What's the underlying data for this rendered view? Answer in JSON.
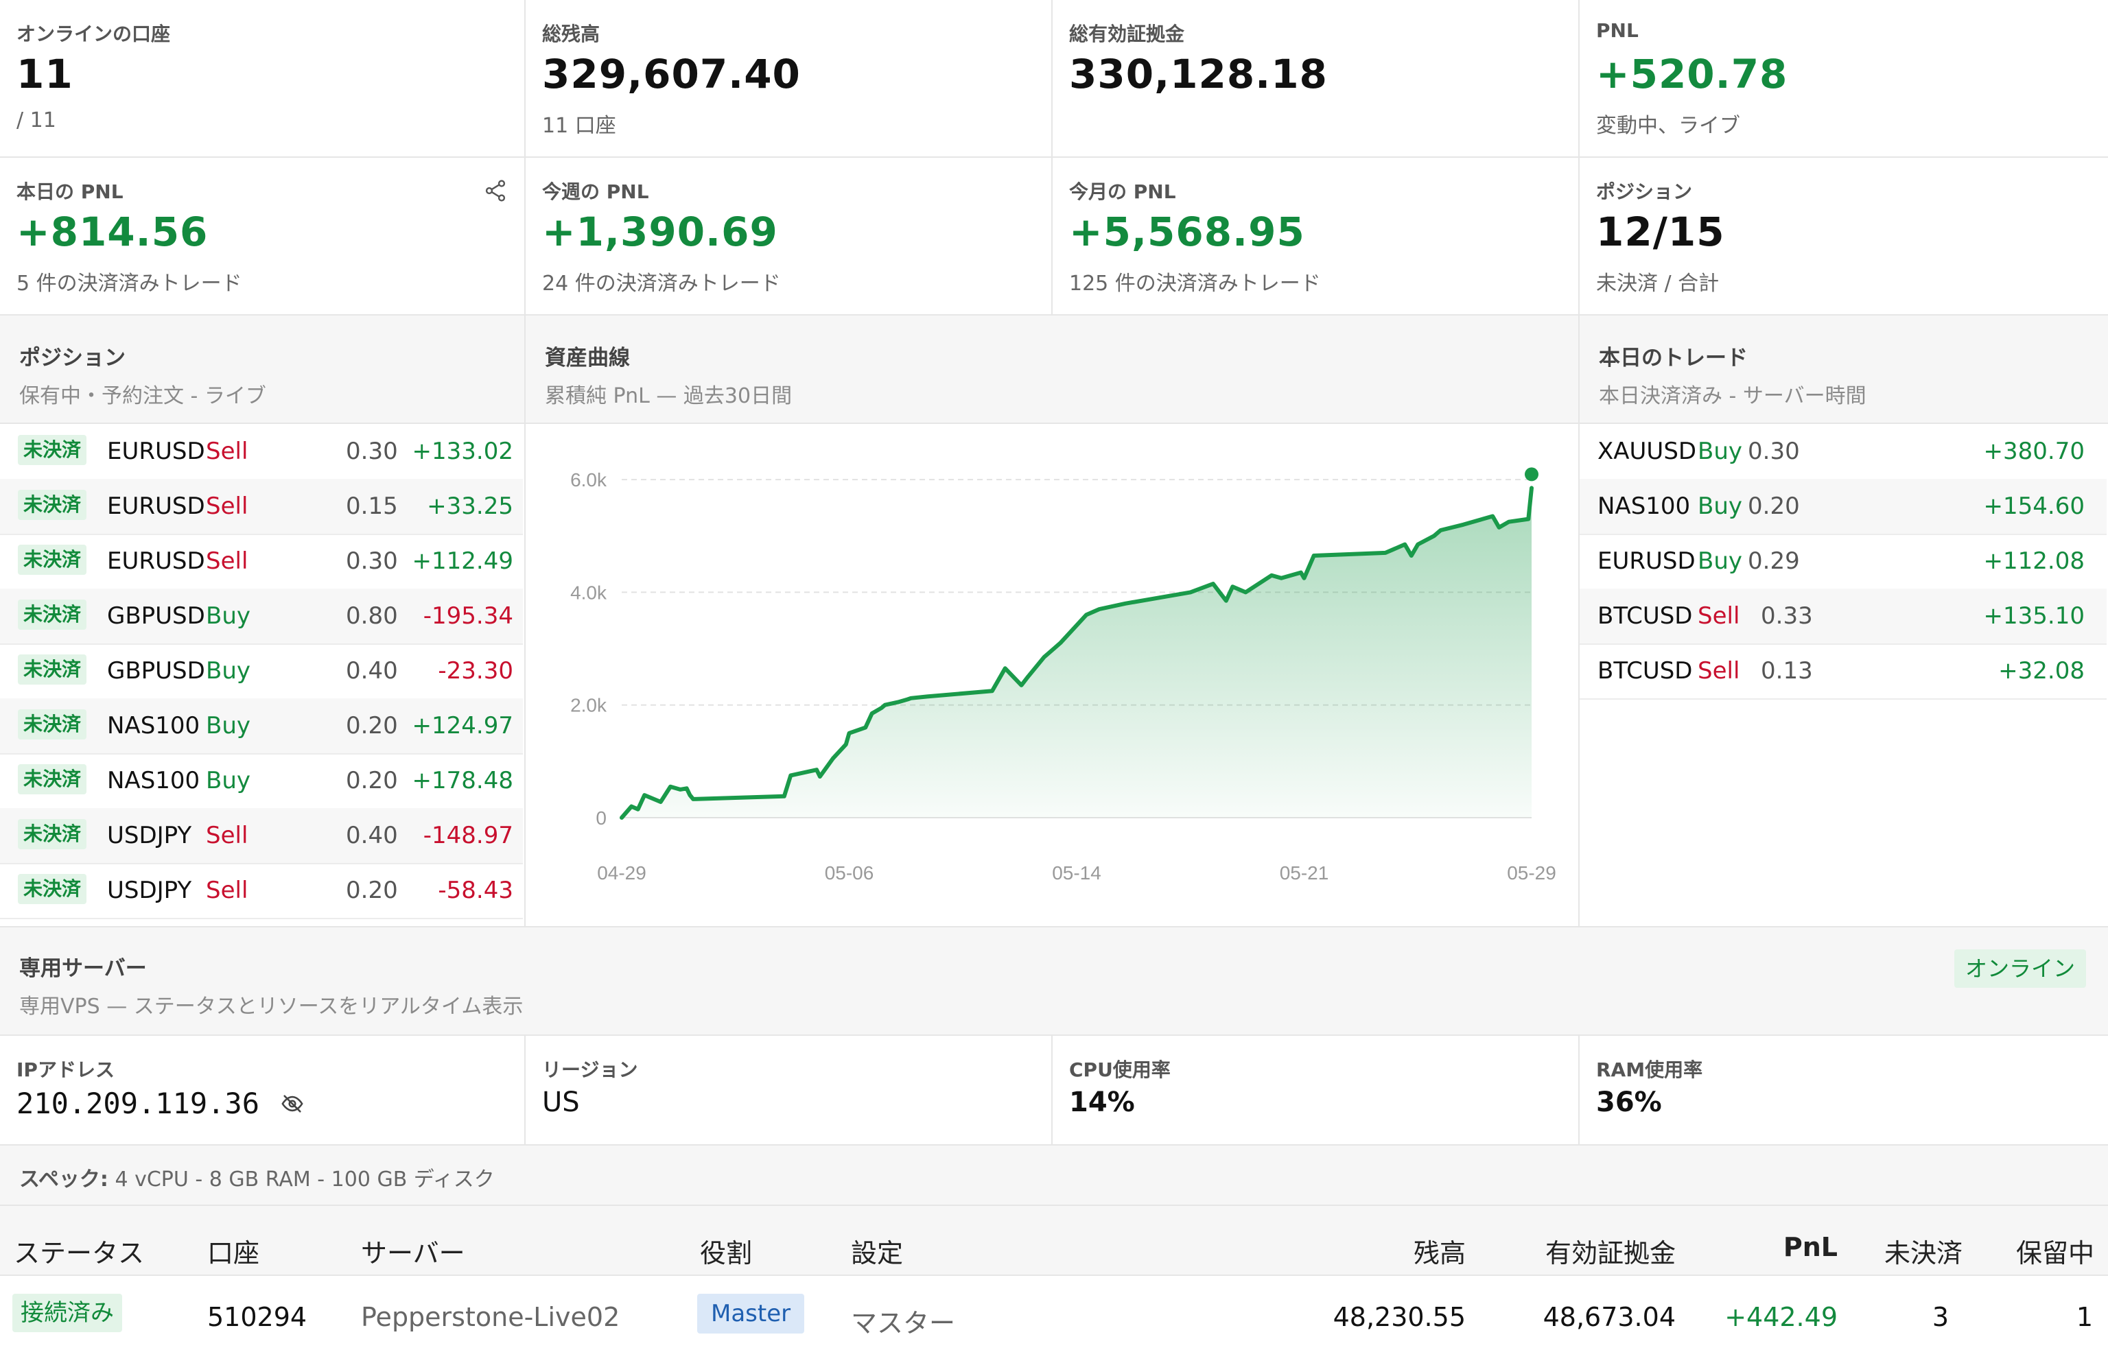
{
  "stats": [
    {
      "label": "オンラインの口座",
      "value": "11",
      "sub": "/ 11"
    },
    {
      "label": "総残高",
      "value": "329,607.40",
      "sub": "11 口座"
    },
    {
      "label": "総有効証拠金",
      "value": "330,128.18",
      "sub": ""
    },
    {
      "label": "PNL",
      "value": "+520.78",
      "sub": "変動中、ライブ"
    },
    {
      "label": "本日の PNL",
      "value": "+814.56",
      "sub": "5 件の決済済みトレード"
    },
    {
      "label": "今週の PNL",
      "value": "+1,390.69",
      "sub": "24 件の決済済みトレード"
    },
    {
      "label": "今月の PNL",
      "value": "+5,568.95",
      "sub": "125 件の決済済みトレード"
    },
    {
      "label": "ポジション",
      "value": "12/15",
      "sub": "未決済 / 合計"
    }
  ],
  "positions_panel": {
    "title": "ポジション",
    "subtitle": "保有中・予約注文 - ライブ",
    "rows": [
      {
        "status": "未決済",
        "symbol": "EURUSD",
        "side": "Sell",
        "volume": "0.30",
        "pnl": "+133.02"
      },
      {
        "status": "未決済",
        "symbol": "EURUSD",
        "side": "Sell",
        "volume": "0.15",
        "pnl": "+33.25"
      },
      {
        "status": "未決済",
        "symbol": "EURUSD",
        "side": "Sell",
        "volume": "0.30",
        "pnl": "+112.49"
      },
      {
        "status": "未決済",
        "symbol": "GBPUSD",
        "side": "Buy",
        "volume": "0.80",
        "pnl": "-195.34"
      },
      {
        "status": "未決済",
        "symbol": "GBPUSD",
        "side": "Buy",
        "volume": "0.40",
        "pnl": "-23.30"
      },
      {
        "status": "未決済",
        "symbol": "NAS100",
        "side": "Buy",
        "volume": "0.20",
        "pnl": "+124.97"
      },
      {
        "status": "未決済",
        "symbol": "NAS100",
        "side": "Buy",
        "volume": "0.20",
        "pnl": "+178.48"
      },
      {
        "status": "未決済",
        "symbol": "USDJPY",
        "side": "Sell",
        "volume": "0.40",
        "pnl": "-148.97"
      },
      {
        "status": "未決済",
        "symbol": "USDJPY",
        "side": "Sell",
        "volume": "0.20",
        "pnl": "-58.43"
      }
    ]
  },
  "equity_panel": {
    "title": "資産曲線",
    "subtitle": "累積純 PnL — 過去30日間"
  },
  "chart_data": {
    "type": "area",
    "title": "",
    "xlabel": "",
    "ylabel": "",
    "ylim": [
      0,
      6500
    ],
    "yticks": [
      0,
      2000,
      4000,
      6000
    ],
    "ytick_labels": [
      "0",
      "2.0k",
      "4.0k",
      "6.0k"
    ],
    "xtick_labels": [
      "04-29",
      "05-06",
      "05-14",
      "05-21",
      "05-29"
    ],
    "grid": true,
    "color": "#1a9a4a",
    "x": [
      0,
      0.3,
      0.5,
      0.7,
      1.2,
      1.5,
      1.8,
      2.0,
      2.1,
      2.2,
      5.0,
      5.2,
      6.0,
      6.1,
      6.5,
      6.9,
      7.0,
      7.5,
      7.7,
      8.0,
      8.1,
      8.5,
      8.8,
      8.9,
      9.4,
      11.4,
      11.8,
      12.3,
      12.5,
      13.0,
      13.3,
      13.5,
      14.3,
      14.7,
      15.5,
      17.5,
      18.2,
      18.6,
      18.8,
      19.2,
      20.0,
      20.3,
      20.9,
      21.0,
      21.3,
      23.5,
      24.1,
      24.3,
      24.5,
      25.0,
      25.2,
      25.9,
      26.8,
      27.0,
      27.3,
      27.9,
      28.0
    ],
    "y": [
      0,
      200,
      150,
      400,
      280,
      550,
      500,
      520,
      400,
      330,
      380,
      750,
      850,
      730,
      1050,
      1300,
      1500,
      1600,
      1850,
      1950,
      2000,
      2050,
      2100,
      2120,
      2150,
      2250,
      2650,
      2350,
      2500,
      2850,
      3000,
      3100,
      3600,
      3700,
      3800,
      4000,
      4150,
      3850,
      4100,
      4000,
      4300,
      4250,
      4350,
      4250,
      4650,
      4700,
      4850,
      4650,
      4850,
      5000,
      5100,
      5200,
      5350,
      5150,
      5250,
      5300,
      5850
    ]
  },
  "trades_panel": {
    "title": "本日のトレード",
    "subtitle": "本日決済済み - サーバー時間",
    "rows": [
      {
        "symbol": "XAUUSD",
        "side": "Buy",
        "volume": "0.30",
        "pnl": "+380.70"
      },
      {
        "symbol": "NAS100",
        "side": "Buy",
        "volume": "0.20",
        "pnl": "+154.60"
      },
      {
        "symbol": "EURUSD",
        "side": "Buy",
        "volume": "0.29",
        "pnl": "+112.08"
      },
      {
        "symbol": "BTCUSD",
        "side": "Sell",
        "volume": "0.33",
        "pnl": "+135.10"
      },
      {
        "symbol": "BTCUSD",
        "side": "Sell",
        "volume": "0.13",
        "pnl": "+32.08"
      }
    ]
  },
  "server": {
    "title": "専用サーバー",
    "subtitle": "専用VPS — ステータスとリソースをリアルタイム表示",
    "status": "オンライン",
    "ip_label": "IPアドレス",
    "ip": "210.209.119.36",
    "region_label": "リージョン",
    "region": "US",
    "cpu_label": "CPU使用率",
    "cpu": "14%",
    "ram_label": "RAM使用率",
    "ram": "36%",
    "specs_label": "スペック:",
    "specs": "4 vCPU - 8 GB RAM - 100 GB ディスク"
  },
  "accounts_table": {
    "headers": {
      "status": "ステータス",
      "account": "口座",
      "server": "サーバー",
      "role": "役割",
      "settings": "設定",
      "balance": "残高",
      "equity": "有効証拠金",
      "pnl": "PnL",
      "open": "未決済",
      "pending": "保留中"
    },
    "rows": [
      {
        "status": "接続済み",
        "account": "510294",
        "server": "Pepperstone-Live02",
        "role": "Master",
        "settings": "マスター",
        "balance": "48,230.55",
        "equity": "48,673.04",
        "pnl": "+442.49",
        "open": "3",
        "pending": "1"
      }
    ]
  },
  "colors": {
    "positive": "#138a3e",
    "negative": "#c8102e",
    "badge_bg": "#e3f4e8",
    "role_bg": "#dbe8f8",
    "role_text": "#1f5fb0"
  }
}
